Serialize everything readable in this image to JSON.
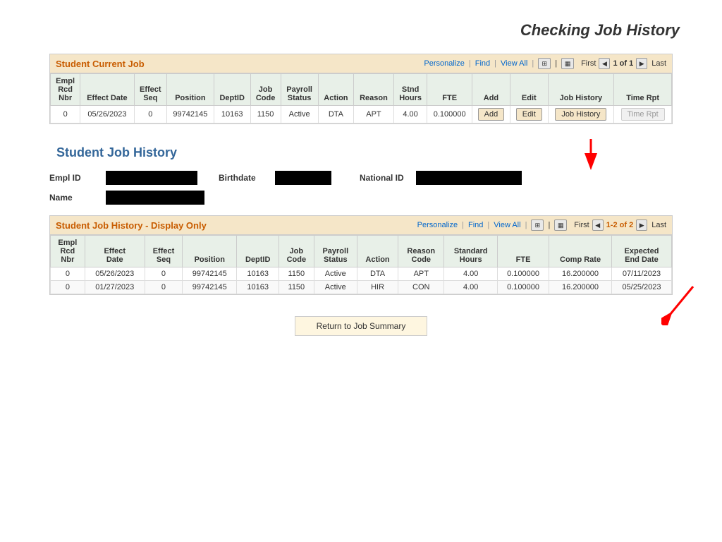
{
  "page": {
    "title": "Checking Job History"
  },
  "current_job_section": {
    "title": "Student Current Job",
    "controls": {
      "personalize": "Personalize",
      "find": "Find",
      "view_all": "View All",
      "first": "First",
      "last": "Last",
      "page_indicator": "1 of 1"
    },
    "columns": [
      "Empl Rcd Nbr",
      "Effect Date",
      "Effect Seq",
      "Position",
      "DeptID",
      "Job Code",
      "Payroll Status",
      "Action",
      "Reason",
      "Stnd Hours",
      "FTE",
      "Add",
      "Edit",
      "Job History",
      "Time Rpt"
    ],
    "rows": [
      {
        "empl_rcd": "0",
        "effect_date": "05/26/2023",
        "effect_seq": "0",
        "position": "99742145",
        "dept_id": "10163",
        "job_code": "1150",
        "payroll_status": "Active",
        "action": "DTA",
        "reason": "APT",
        "stnd_hours": "4.00",
        "fte": "0.100000",
        "add_btn": "Add",
        "edit_btn": "Edit",
        "job_history_btn": "Job History",
        "time_rpt_btn": "Time Rpt"
      }
    ]
  },
  "student_job_history_section": {
    "title": "Student Job History",
    "fields": {
      "empl_id_label": "Empl ID",
      "birthdate_label": "Birthdate",
      "national_id_label": "National ID",
      "name_label": "Name"
    }
  },
  "job_history_table_section": {
    "title": "Student Job History - Display Only",
    "controls": {
      "personalize": "Personalize",
      "find": "Find",
      "view_all": "View All",
      "first": "First",
      "last": "Last",
      "page_indicator": "1-2 of 2"
    },
    "columns": [
      "Empl Rcd Nbr",
      "Effect Date",
      "Effect Seq",
      "Position",
      "DeptID",
      "Job Code",
      "Payroll Status",
      "Action",
      "Reason Code",
      "Standard Hours",
      "FTE",
      "Comp Rate",
      "Expected End Date"
    ],
    "rows": [
      {
        "empl_rcd": "0",
        "effect_date": "05/26/2023",
        "effect_seq": "0",
        "position": "99742145",
        "dept_id": "10163",
        "job_code": "1150",
        "payroll_status": "Active",
        "action": "DTA",
        "reason_code": "APT",
        "standard_hours": "4.00",
        "fte": "0.100000",
        "comp_rate": "16.200000",
        "expected_end_date": "07/11/2023"
      },
      {
        "empl_rcd": "0",
        "effect_date": "01/27/2023",
        "effect_seq": "0",
        "position": "99742145",
        "dept_id": "10163",
        "job_code": "1150",
        "payroll_status": "Active",
        "action": "HIR",
        "reason_code": "CON",
        "standard_hours": "4.00",
        "fte": "0.100000",
        "comp_rate": "16.200000",
        "expected_end_date": "05/25/2023"
      }
    ]
  },
  "return_btn": {
    "label": "Return to Job Summary"
  }
}
